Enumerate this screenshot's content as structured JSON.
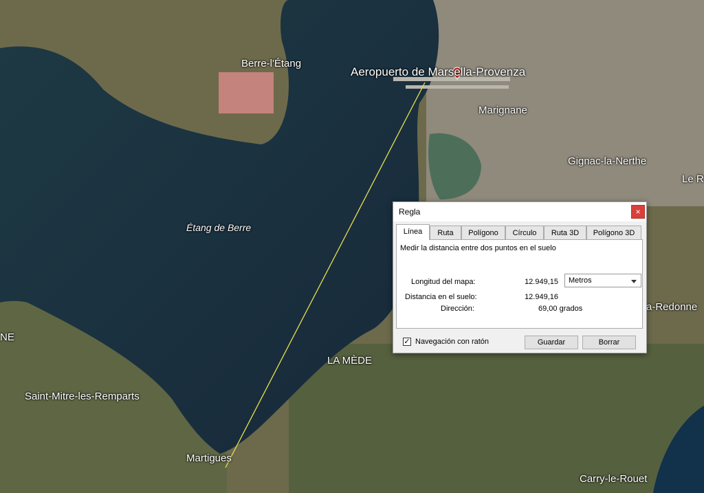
{
  "map": {
    "places": {
      "berre": "Berre-l'Étang",
      "airport": "Aeropuerto de Marsella-Provenza",
      "marignane": "Marignane",
      "gignac": "Gignac-la-Nerthe",
      "re": "Le R",
      "etang": "Étang de Berre",
      "redonne": "a-Redonne",
      "ne": "NE",
      "lamede": "LA MÈDE",
      "saintmitre": "Saint-Mitre-les-Remparts",
      "martigues": "Martigues",
      "carry": "Carry-le-Rouet"
    },
    "measure_line_color": "#e8e24a",
    "pin_color": "#d23b2c"
  },
  "dialog": {
    "title": "Regla",
    "close": "×",
    "tabs": [
      "Línea",
      "Ruta",
      "Polígono",
      "Círculo",
      "Ruta 3D",
      "Polígono 3D"
    ],
    "active_tab": "Línea",
    "description": "Medir la distancia entre dos puntos en el suelo",
    "map_length_label": "Longitud del mapa:",
    "map_length_value": "12.949,15",
    "unit": "Metros",
    "ground_distance_label": "Distancia en el suelo:",
    "ground_distance_value": "12.949,16",
    "heading_label": "Dirección:",
    "heading_value": "69,00 grados",
    "nav_checkbox_mark": "✓",
    "nav_checkbox_label": "Navegación con ratón",
    "save_button": "Guardar",
    "clear_button": "Borrar"
  }
}
